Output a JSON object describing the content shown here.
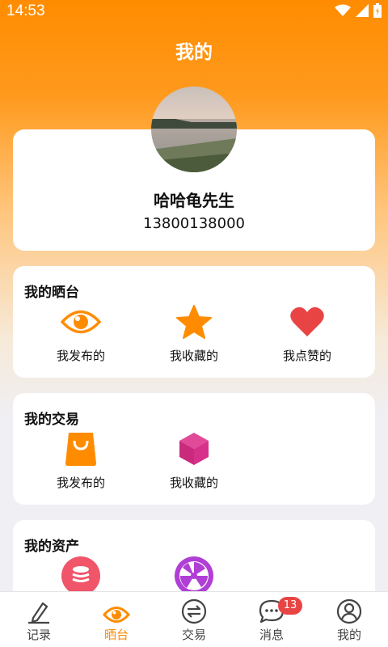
{
  "status": {
    "time": "14:53"
  },
  "header": {
    "title": "我的"
  },
  "profile": {
    "name": "哈哈龟先生",
    "phone": "13800138000"
  },
  "sections": {
    "showcase": {
      "title": "我的晒台",
      "items": [
        {
          "label": "我发布的",
          "icon": "eye-icon"
        },
        {
          "label": "我收藏的",
          "icon": "star-icon"
        },
        {
          "label": "我点赞的",
          "icon": "heart-icon"
        }
      ]
    },
    "trade": {
      "title": "我的交易",
      "items": [
        {
          "label": "我发布的",
          "icon": "shopping-bag-icon"
        },
        {
          "label": "我收藏的",
          "icon": "cube-icon"
        }
      ]
    },
    "assets": {
      "title": "我的资产",
      "items": [
        {
          "icon": "coins-icon"
        },
        {
          "icon": "wheel-icon"
        }
      ]
    }
  },
  "nav": {
    "items": [
      {
        "label": "记录",
        "icon": "pen-icon"
      },
      {
        "label": "晒台",
        "icon": "eye-icon",
        "active": true
      },
      {
        "label": "交易",
        "icon": "exchange-icon"
      },
      {
        "label": "消息",
        "icon": "chat-icon",
        "badge": "13"
      },
      {
        "label": "我的",
        "icon": "user-icon"
      }
    ]
  },
  "colors": {
    "accent": "#ff8c00",
    "heart": "#e94444",
    "cube": "#d6308a",
    "coins": "#f0556a",
    "wheel": "#b03fd6"
  }
}
